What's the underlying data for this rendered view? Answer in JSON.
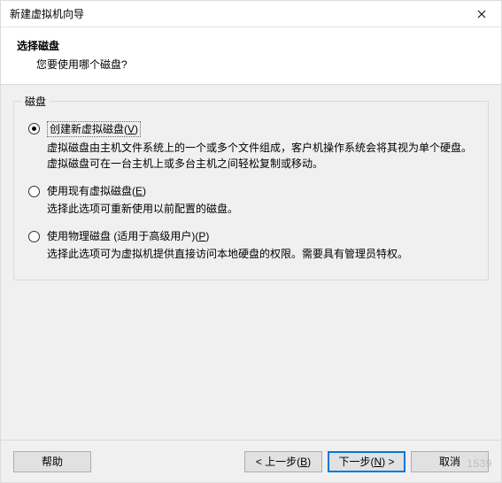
{
  "titlebar": {
    "title": "新建虚拟机向导"
  },
  "header": {
    "title": "选择磁盘",
    "subtitle": "您要使用哪个磁盘?"
  },
  "group": {
    "legend": "磁盘"
  },
  "options": [
    {
      "label_pre": "创建新虚拟磁盘(",
      "mnemonic": "V",
      "label_post": ")",
      "desc": "虚拟磁盘由主机文件系统上的一个或多个文件组成，客户机操作系统会将其视为单个硬盘。虚拟磁盘可在一台主机上或多台主机之间轻松复制或移动。",
      "checked": true,
      "boxed": true
    },
    {
      "label_pre": "使用现有虚拟磁盘(",
      "mnemonic": "E",
      "label_post": ")",
      "desc": "选择此选项可重新使用以前配置的磁盘。",
      "checked": false,
      "boxed": false
    },
    {
      "label_pre": "使用物理磁盘 (适用于高级用户)(",
      "mnemonic": "P",
      "label_post": ")",
      "desc": "选择此选项可为虚拟机提供直接访问本地硬盘的权限。需要具有管理员特权。",
      "checked": false,
      "boxed": false
    }
  ],
  "footer": {
    "help": "帮助",
    "back_pre": "< 上一步(",
    "back_mn": "B",
    "back_post": ")",
    "next_pre": "下一步(",
    "next_mn": "N",
    "next_post": ") >",
    "cancel": "取消"
  },
  "watermark": "1539"
}
